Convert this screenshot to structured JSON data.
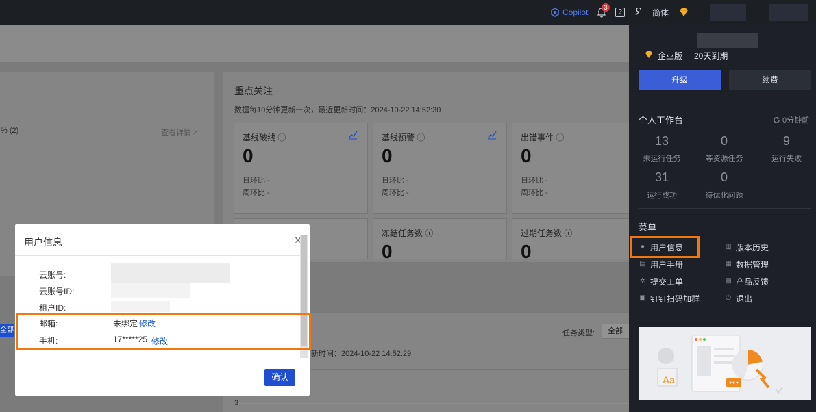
{
  "topbar": {
    "copilot_label": "Copilot",
    "notification_count": "3",
    "help_glyph": "?",
    "language_label": "简体"
  },
  "dashboard": {
    "left_percent": "% (2)",
    "view_details": "查看详情 >",
    "focus": {
      "title": "重点关注",
      "update_note": "数据每10分钟更新一次，最近更新时间：2024-10-22 14:52:30"
    },
    "stats": [
      {
        "label": "基线破线 ⓘ",
        "value": "0",
        "day": "日环比 -",
        "week": "周环比 -"
      },
      {
        "label": "基线预警 ⓘ",
        "value": "0",
        "day": "日环比 -",
        "week": "周环比 -"
      },
      {
        "label": "出错事件 ⓘ",
        "value": "0",
        "day": "日环比 -",
        "week": "周环比 -"
      },
      {
        "label": "冻结任务数 ⓘ",
        "value": "0"
      },
      {
        "label": "过期任务数 ⓘ",
        "value": "0"
      }
    ],
    "all_badge": "全部",
    "task_type_label": "任务类型:",
    "task_type_value": "全部",
    "update_time": "新时间：2024-10-22 14:52:29",
    "y_tick": "3"
  },
  "modal": {
    "title": "用户信息",
    "fields": {
      "cloud_account_label": "云账号:",
      "cloud_account_id_label": "云账号ID:",
      "tenant_id_label": "租户ID:",
      "email_label": "邮箱:",
      "email_value": "未绑定",
      "email_edit": "修改",
      "phone_label": "手机:",
      "phone_value": "17*****25",
      "phone_edit": "修改"
    },
    "confirm_label": "确认"
  },
  "panel": {
    "edition": "企业版",
    "expiry": "20天到期",
    "upgrade_label": "升级",
    "renew_label": "续费",
    "workspace_title": "个人工作台",
    "refresh_label": "0分钟前",
    "workspace_stats": [
      {
        "value": "13",
        "label": "未运行任务"
      },
      {
        "value": "0",
        "label": "等资源任务"
      },
      {
        "value": "9",
        "label": "运行失败"
      },
      {
        "value": "31",
        "label": "运行成功"
      },
      {
        "value": "0",
        "label": "待优化问题"
      }
    ],
    "menu_title": "菜单",
    "menu": [
      {
        "label": "用户信息",
        "icon": "user-icon"
      },
      {
        "label": "版本历史",
        "icon": "history-icon"
      },
      {
        "label": "用户手册",
        "icon": "book-icon"
      },
      {
        "label": "数据管理",
        "icon": "data-icon"
      },
      {
        "label": "提交工单",
        "icon": "gear-icon"
      },
      {
        "label": "产品反馈",
        "icon": "feedback-icon"
      },
      {
        "label": "钉钉扫码加群",
        "icon": "qr-icon"
      },
      {
        "label": "退出",
        "icon": "power-icon"
      }
    ]
  },
  "colors": {
    "accent_blue": "#3b5dd8",
    "highlight_orange": "#f07810",
    "link_blue": "#1a5bd6"
  }
}
